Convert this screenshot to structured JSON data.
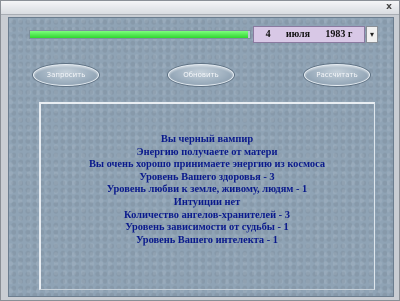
{
  "window": {
    "close_glyph": "x"
  },
  "progress": {
    "fill_fraction": 0.99,
    "color": "#2fd62f"
  },
  "date": {
    "day": "4",
    "month": "июля",
    "year": "1983 г",
    "spin_glyph": "▾"
  },
  "buttons": [
    {
      "label": "Запросить"
    },
    {
      "label": "Обновить"
    },
    {
      "label": "Рассчитать"
    }
  ],
  "results": [
    "Вы черный вампир",
    "Энергию получаете от матери",
    "Вы очень хорошо принимаете энергию из космоса",
    "Уровень Вашего здоровья - 3",
    "Уровень любви к земле, живому, людям - 1",
    "Интуиции нет",
    "Количество ангелов-хранителей - 3",
    "Уровень зависимости от судьбы - 1",
    "Уровень Вашего интелекта - 1"
  ],
  "colors": {
    "result_text": "#0a1a8c",
    "panel": "#8fa3b5",
    "date_box": "#d8c8e6"
  }
}
